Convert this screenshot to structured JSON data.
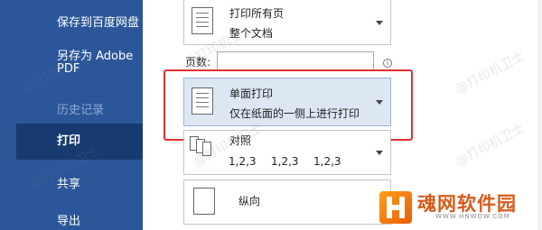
{
  "sidebar": {
    "items": [
      {
        "label": "保存到百度网盘",
        "state": "normal"
      },
      {
        "label": "另存为 Adobe",
        "label2": "PDF",
        "state": "normal"
      },
      {
        "label": "历史记录",
        "state": "disabled"
      },
      {
        "label": "打印",
        "state": "active"
      },
      {
        "label": "共享",
        "state": "normal"
      },
      {
        "label": "导出",
        "state": "normal"
      }
    ]
  },
  "print_settings": {
    "range": {
      "title": "打印所有页",
      "subtitle": "整个文档"
    },
    "pages_label": "页数:",
    "pages_value": "",
    "info_icon": "i",
    "sides": {
      "title": "单面打印",
      "subtitle": "仅在纸面的一侧上进行打印"
    },
    "collate": {
      "title": "对照",
      "numbers": [
        "1,2,3",
        "1,2,3",
        "1,2,3"
      ]
    },
    "orientation": {
      "title": "纵向"
    }
  },
  "watermark": "@打印机卫士",
  "logo": {
    "text": "魂网软件园",
    "url": "WWW.HNWDW.COM"
  },
  "colors": {
    "sidebar": "#2b579a",
    "sidebar_active": "#173a70",
    "highlight": "#e03030",
    "selected": "#dde7f4"
  }
}
